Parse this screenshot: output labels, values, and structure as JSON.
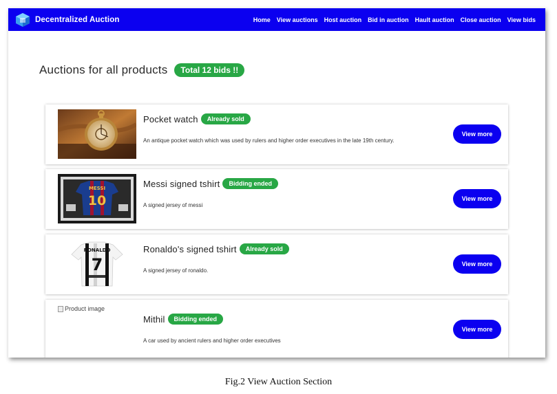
{
  "app": {
    "brand_name": "Decentralized Auction"
  },
  "nav": {
    "links": [
      "Home",
      "View auctions",
      "Host auction",
      "Bid in auction",
      "Hault auction",
      "Close auction",
      "View bids"
    ]
  },
  "main": {
    "title": "Auctions for all products",
    "total_badge": "Total 12 bids !!"
  },
  "products": [
    {
      "title": "Pocket watch",
      "status": "Already sold",
      "description": "An antique pocket watch which was used by rulers and higher order executives in the late 19th century.",
      "button": "View more"
    },
    {
      "title": "Messi signed tshirt",
      "status": "Bidding ended",
      "description": "A signed jersey of messi",
      "button": "View more"
    },
    {
      "title": "Ronaldo's signed tshirt",
      "status": "Already sold",
      "description": "A signed jersey of ronaldo.",
      "button": "View more"
    },
    {
      "title": "Mithil",
      "status": "Bidding ended",
      "description": "A car used by ancient rulers and higher order executives",
      "button": "View more",
      "image_alt": "Product image"
    }
  ],
  "caption": "Fig.2 View Auction Section",
  "colors": {
    "nav": "#0b00f0",
    "badge": "#28a745",
    "button": "#0b00f0"
  },
  "images": {
    "messi_shirt": {
      "name": "MESSI",
      "number": "10"
    },
    "ronaldo_shirt": {
      "name": "RONALDO",
      "number": "7"
    }
  }
}
